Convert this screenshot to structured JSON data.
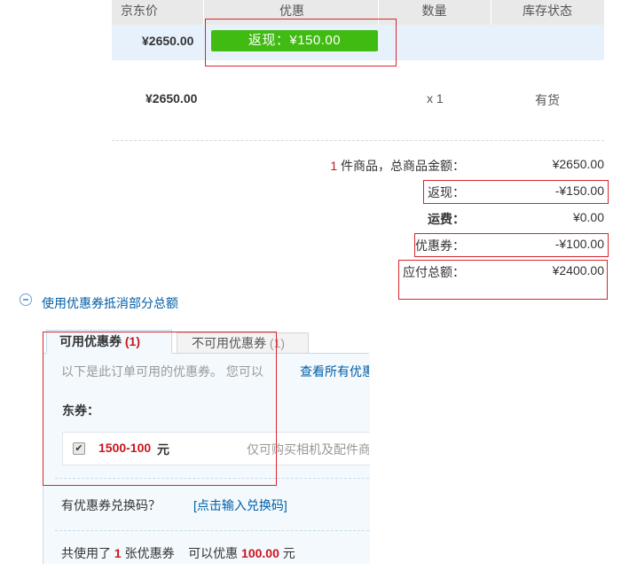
{
  "table": {
    "headers": [
      "京东价",
      "优惠",
      "数量",
      "库存状态"
    ],
    "row_discount": {
      "price": "¥2650.00",
      "cashback": "返现：¥150.00"
    },
    "row_item": {
      "price": "¥2650.00",
      "quantity": "x 1",
      "stock": "有货"
    }
  },
  "summary": {
    "count": "1",
    "count_label": "件商品，总商品金额：",
    "total_value": "¥2650.00",
    "cashback_label": "返现：",
    "cashback_value": "-¥150.00",
    "shipping_label": "运费：",
    "shipping_value": "¥0.00",
    "coupon_label": "优惠券：",
    "coupon_value": "-¥100.00",
    "payable_label": "应付总额：",
    "payable_value": "¥2400.00"
  },
  "coupon_section": {
    "toggle_label": "使用优惠券抵消部分总额",
    "tabs": [
      {
        "label": "可用优惠券",
        "count": "(1)"
      },
      {
        "label": "不可用优惠券",
        "count": "(1)"
      }
    ],
    "notice": "以下是此订单可用的优惠券。 您可以",
    "view_all": "查看所有优惠",
    "group_title": "东券：",
    "coupon": {
      "name": "1500-100",
      "unit": "元",
      "desc": "仅可购买相机及配件商"
    },
    "redeem_label": "有优惠券兑换码？",
    "redeem_link": "[点击输入兑换码]",
    "used_prefix": "共使用了",
    "used_count": "1",
    "used_mid": "张优惠券    可以优惠",
    "used_amount": "100.00",
    "used_unit": "元"
  },
  "colors": {
    "accent_green": "#3fbb11",
    "highlight_red": "#d9262b",
    "link_blue": "#005ea7",
    "row_blue": "#e7f1fc"
  }
}
